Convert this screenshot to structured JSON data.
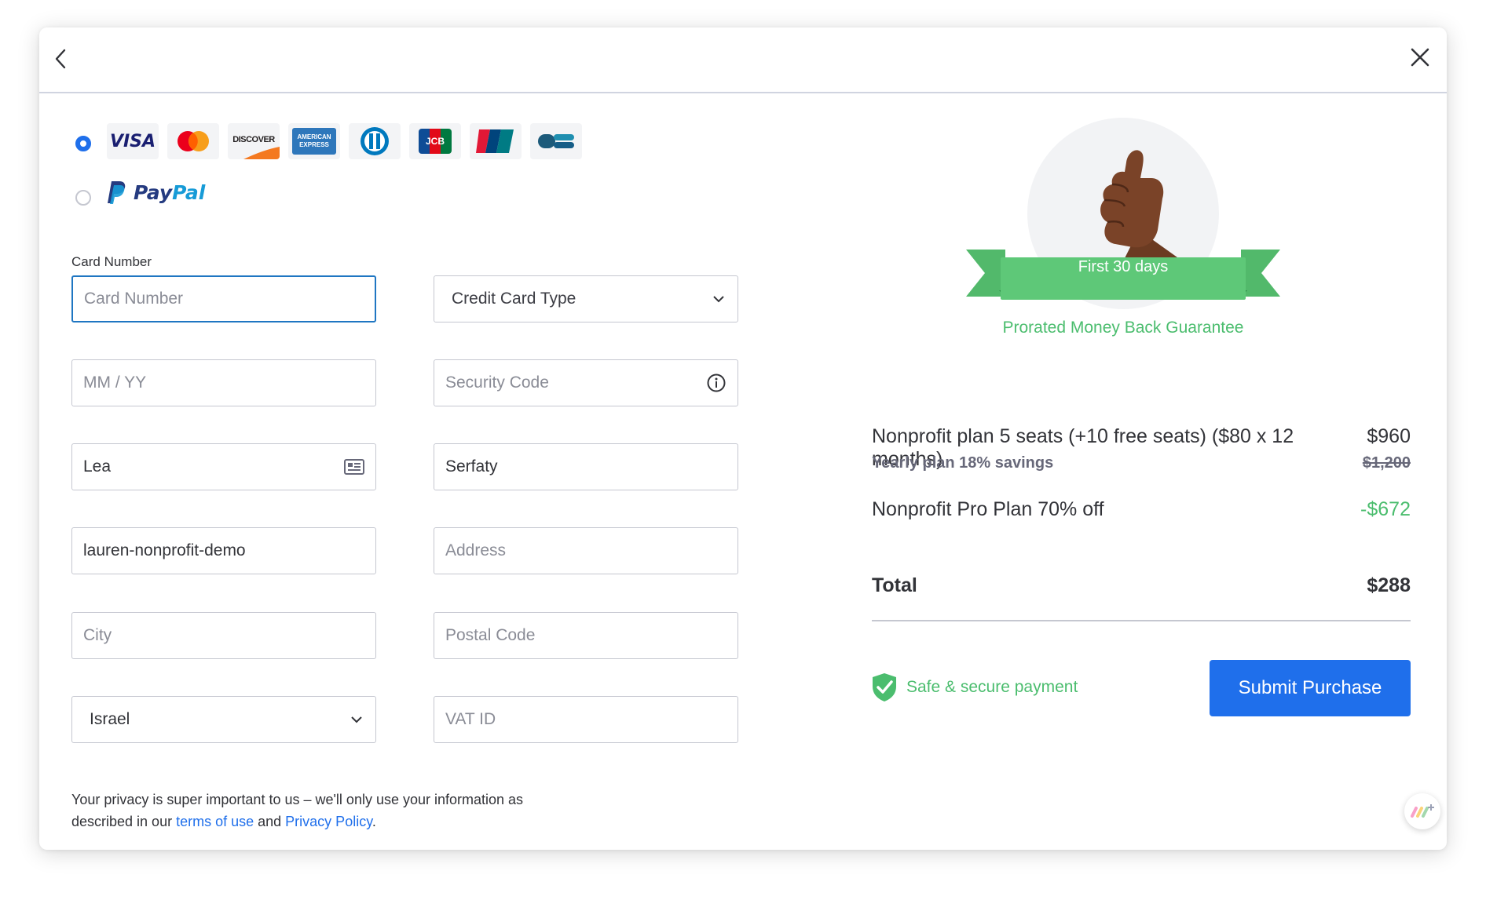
{
  "payment_methods": {
    "card_brands": [
      "visa-logo",
      "mastercard-logo",
      "discover-logo",
      "american-express-logo",
      "diners-club-logo",
      "jcb-logo",
      "unionpay-logo",
      "cartes-bancaires-logo"
    ],
    "card_labels": {
      "visa": "VISA",
      "discover": "DISCOVER",
      "amex": "AMERICAN EXPRESS",
      "jcb": "JCB",
      "unionpay": "UnionPay"
    },
    "paypal_label_pay": "Pay",
    "paypal_label_pal": "Pal",
    "selected": "card"
  },
  "form": {
    "card_number_label": "Card Number",
    "card_number_placeholder": "Card Number",
    "card_type_value": "Credit Card Type",
    "expiry_placeholder": "MM / YY",
    "security_code_placeholder": "Security Code",
    "first_name_value": "Lea",
    "last_name_value": "Serfaty",
    "company_value": "lauren-nonprofit-demo",
    "address_placeholder": "Address",
    "city_placeholder": "City",
    "postal_code_placeholder": "Postal Code",
    "country_value": "Israel",
    "vat_placeholder": "VAT ID"
  },
  "privacy": {
    "text_before": "Your privacy is super important to us – we'll only use your information as described in our ",
    "terms_link": "terms of use",
    "and": " and ",
    "policy_link": "Privacy Policy",
    "period": "."
  },
  "guarantee": {
    "ribbon_text": "First 30 days",
    "subtitle": "Prorated Money Back Guarantee"
  },
  "summary": {
    "plan_desc": "Nonprofit plan 5 seats (+10 free seats)  ($80 x 12 months)",
    "plan_price": "$960",
    "savings_label": "Yearly plan 18% savings",
    "original_price": "$1,200",
    "discount_label": "Nonprofit Pro Plan 70% off",
    "discount_value": "-$672",
    "total_label": "Total",
    "total_value": "$288"
  },
  "footer": {
    "secure_label": "Safe & secure payment",
    "submit_label": "Submit Purchase"
  },
  "colors": {
    "primary": "#1f6feb",
    "success": "#4bbd6e",
    "ribbon": "#5ec878",
    "text": "#323338"
  }
}
